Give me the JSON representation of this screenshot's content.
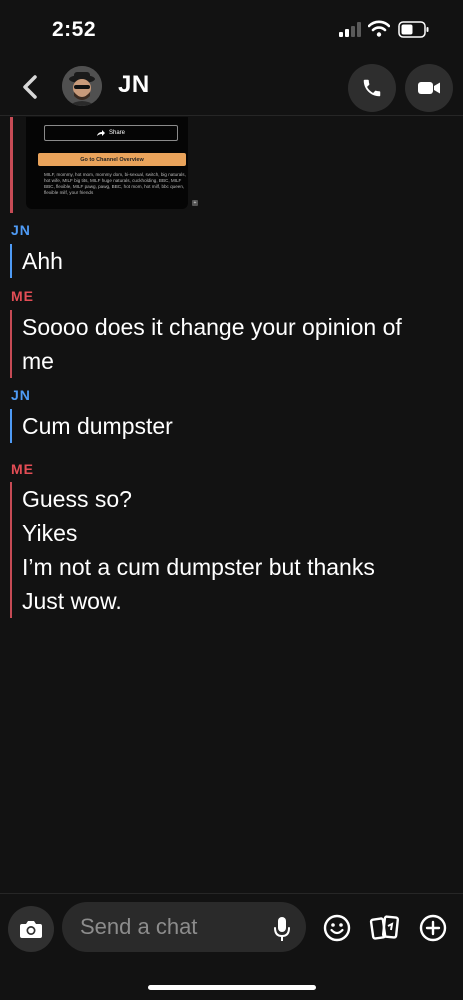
{
  "status_bar": {
    "time": "2:52"
  },
  "header": {
    "contact_name": "JN"
  },
  "preview": {
    "share_label": "Share",
    "channel_button_label": "Go to Channel Overview",
    "tags": "MILF, mommy, hot mom, mommy dom, bi-sexual, switch, big naturals, hot wife, MILF big tits, MILF huge naturals, cuckholding, BBC, MILF BBC, flexible, MILF pawg, pawg, BBC, hot mom, hot milf, bbc queen, flexible milf, your friends",
    "plus": "+"
  },
  "messages": [
    {
      "sender": "JN",
      "lines": [
        "Ahh"
      ]
    },
    {
      "sender": "ME",
      "lines": [
        "Soooo does it change your opinion of",
        "me"
      ]
    },
    {
      "sender": "JN",
      "lines": [
        "Cum dumpster"
      ]
    },
    {
      "sender": "ME",
      "lines": [
        "Guess so?",
        "Yikes",
        "I’m not a cum dumpster but thanks",
        "Just wow."
      ]
    }
  ],
  "composer": {
    "placeholder": "Send a chat"
  },
  "colors": {
    "jn": "#4f9bf5",
    "me": "#e34d55",
    "background": "#121212"
  },
  "icons": [
    "back-chevron-icon",
    "phone-icon",
    "video-camera-icon",
    "camera-icon",
    "microphone-icon",
    "emoji-icon",
    "cards-icon",
    "plus-icon"
  ]
}
